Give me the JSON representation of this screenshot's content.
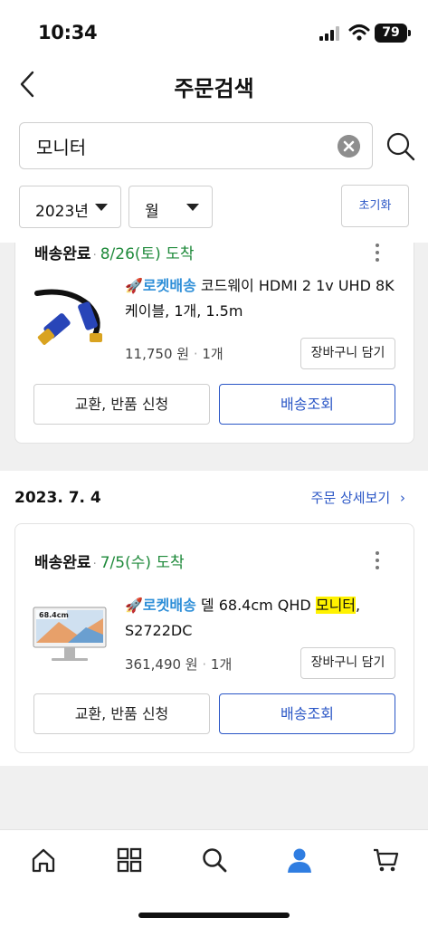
{
  "status_bar": {
    "time": "10:34",
    "battery": "79"
  },
  "header": {
    "title": "주문검색"
  },
  "search": {
    "value": "모니터"
  },
  "filters": {
    "year": "2023년",
    "month": "월",
    "reset_label": "초기화"
  },
  "orders": [
    {
      "status": "배송완료",
      "arrival": "8/26(토) 도착",
      "item": {
        "rocket_label": "로켓배송",
        "name": " 코드웨이 HDMI 2 1v UHD 8K 케이블, 1개, 1.5m",
        "price": "11,750 원",
        "qty": "1개"
      },
      "cart_label": "장바구니 담기",
      "exchange_label": "교환, 반품 신청",
      "track_label": "배송조회"
    },
    {
      "date": "2023. 7. 4",
      "detail_label": "주문 상세보기",
      "status": "배송완료",
      "arrival": "7/5(수) 도착",
      "item": {
        "rocket_label": "로켓배송",
        "name_pre": " 델 68.4cm QHD ",
        "name_highlight": "모니터",
        "name_post": ", S2722DC",
        "thumb_label": "68.4cm",
        "price": "361,490 원",
        "qty": "1개"
      },
      "cart_label": "장바구니 담기",
      "exchange_label": "교환, 반품 신청",
      "track_label": "배송조회"
    }
  ],
  "nav": [
    "home-icon",
    "categories-icon",
    "search-icon",
    "my-account-icon",
    "cart-icon"
  ],
  "colors": {
    "accent": "#2a56c6",
    "arrival_green": "#1f8a3b",
    "rocket_blue": "#2f8fd8",
    "highlight": "#fff200"
  }
}
